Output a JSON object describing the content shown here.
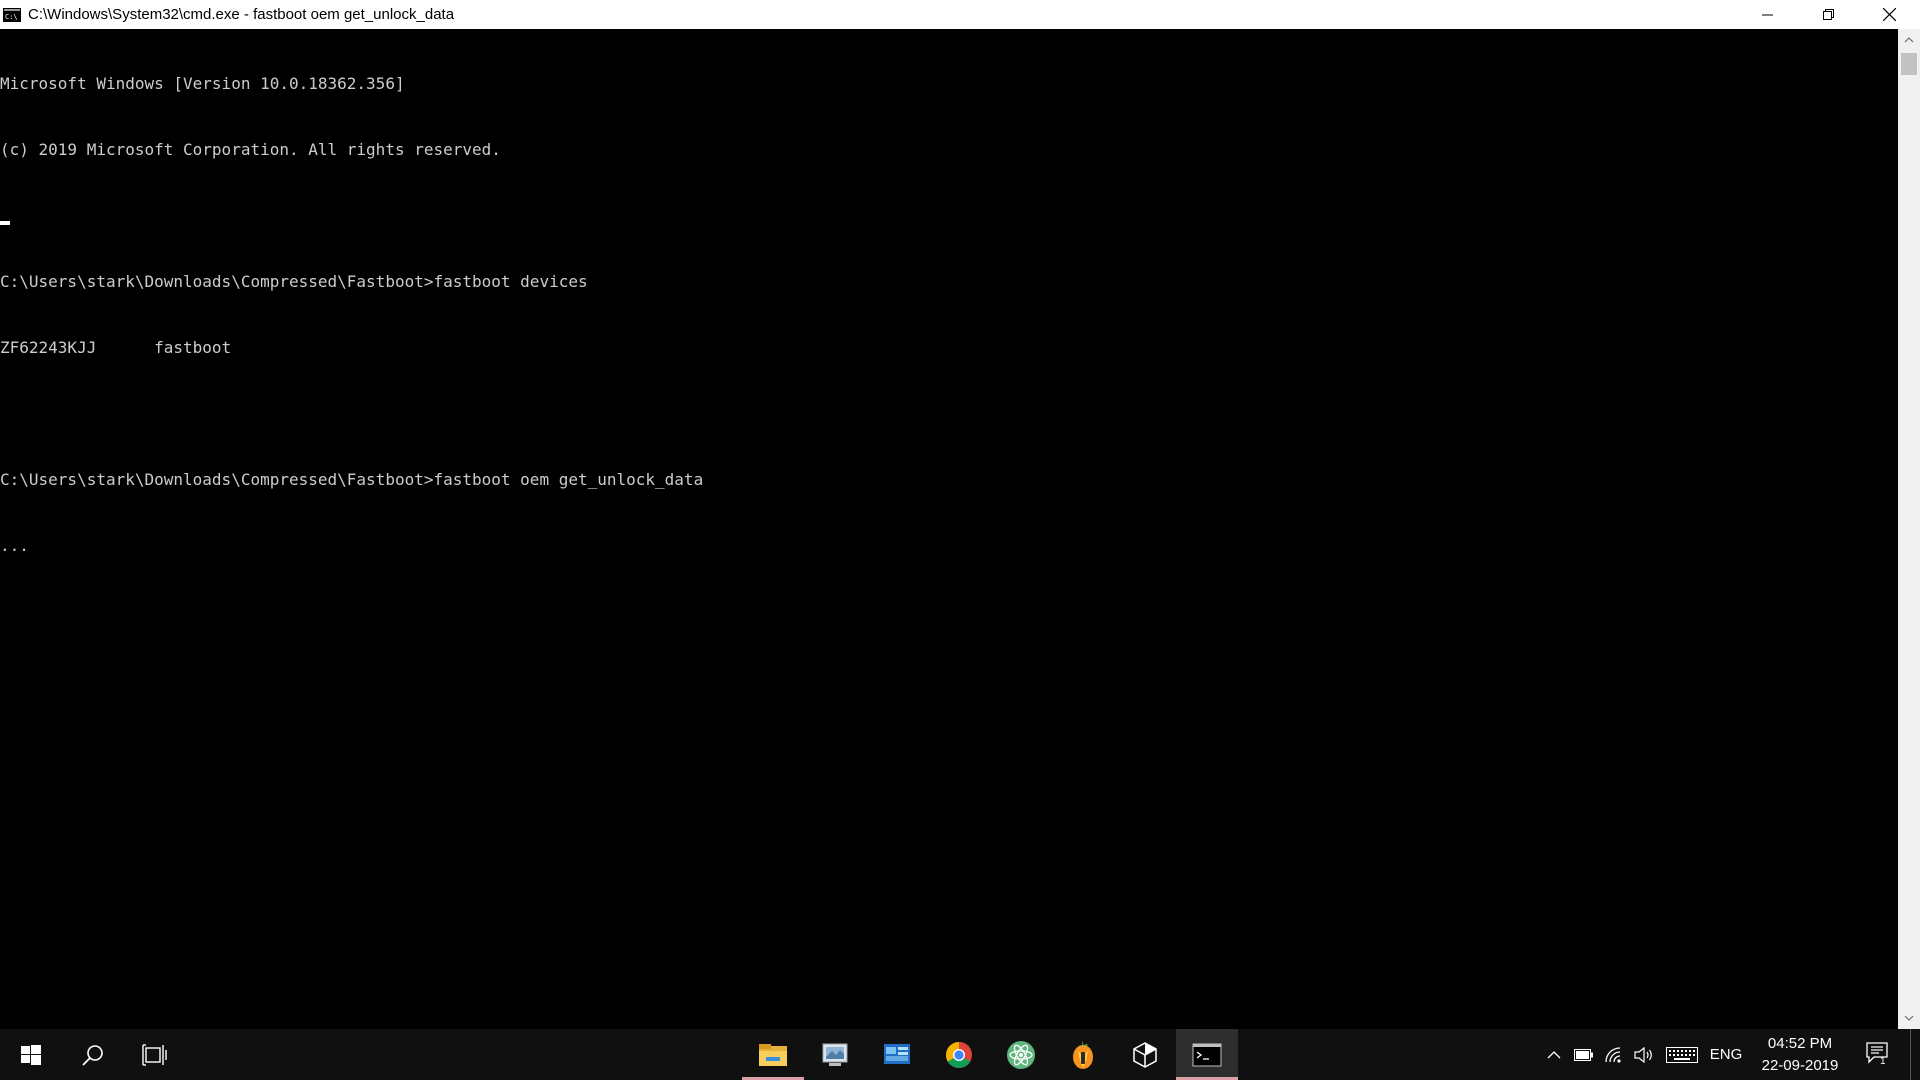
{
  "window": {
    "title": "C:\\Windows\\System32\\cmd.exe - fastboot  oem get_unlock_data",
    "minimize_icon": "minimize-icon",
    "restore_icon": "restore-icon",
    "close_icon": "close-icon"
  },
  "console": {
    "lines": [
      "Microsoft Windows [Version 10.0.18362.356]",
      "(c) 2019 Microsoft Corporation. All rights reserved.",
      "",
      "C:\\Users\\stark\\Downloads\\Compressed\\Fastboot>fastboot devices",
      "ZF62243KJJ      fastboot",
      "",
      "C:\\Users\\stark\\Downloads\\Compressed\\Fastboot>fastboot oem get_unlock_data",
      "..."
    ]
  },
  "taskbar": {
    "start_icon": "windows-start-icon",
    "search_icon": "search-icon",
    "task_view_icon": "task-view-icon",
    "apps": [
      {
        "icon": "file-explorer-icon",
        "active": true,
        "selected": false
      },
      {
        "icon": "control-panel-icon",
        "active": false,
        "selected": false
      },
      {
        "icon": "system-app-icon",
        "active": false,
        "selected": false
      },
      {
        "icon": "chrome-icon",
        "active": false,
        "selected": false
      },
      {
        "icon": "atom-icon",
        "active": false,
        "selected": false
      },
      {
        "icon": "fl-studio-icon",
        "active": false,
        "selected": false
      },
      {
        "icon": "unity-icon",
        "active": false,
        "selected": false
      },
      {
        "icon": "command-prompt-icon",
        "active": true,
        "selected": true
      }
    ],
    "tray": {
      "language": "ENG",
      "time": "04:52 PM",
      "date": "22-09-2019",
      "notification_count": "1"
    }
  }
}
